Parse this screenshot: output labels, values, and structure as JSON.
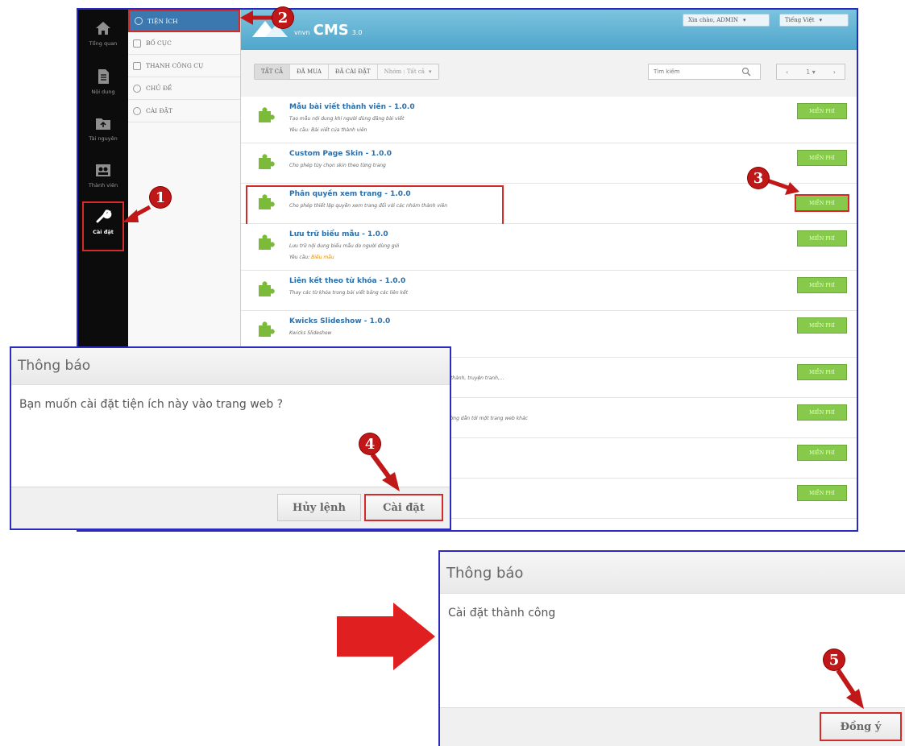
{
  "nav": {
    "items": [
      {
        "label": "Tổng quan",
        "icon": "home-icon"
      },
      {
        "label": "Nội dung",
        "icon": "document-icon"
      },
      {
        "label": "Tài nguyên",
        "icon": "folder-icon"
      },
      {
        "label": "Thành viên",
        "icon": "users-icon"
      },
      {
        "label": "Cài đặt",
        "icon": "wrench-icon"
      }
    ]
  },
  "submenu": {
    "items": [
      {
        "label": "TIỆN ÍCH"
      },
      {
        "label": "BỐ CỤC"
      },
      {
        "label": "THANH CÔNG CỤ"
      },
      {
        "label": "CHỦ ĐỀ"
      },
      {
        "label": "CÀI ĐẶT"
      }
    ]
  },
  "header": {
    "logo_small": "vnvn",
    "logo_big": "CMS",
    "logo_version": "3.0",
    "user_menu": "Xin chào, ADMIN",
    "language": "Tiếng Việt"
  },
  "toolbar": {
    "filters": [
      "TẤT CẢ",
      "ĐÃ MUA",
      "ĐÃ CÀI ĐẶT",
      "Nhóm : Tất cả"
    ],
    "search_placeholder": "Tìm kiếm",
    "page": "1"
  },
  "plugins": [
    {
      "title": "Mẫu bài viết thành viên - 1.0.0",
      "desc": "Tạo mẫu nội dung khi người dùng đăng bài viết",
      "req_label": "Yêu cầu:",
      "req_value": "Bài viết của thành viên",
      "button": "MIỄN PHÍ"
    },
    {
      "title": "Custom Page Skin - 1.0.0",
      "desc": "Cho phép tùy chọn skin theo từng trang",
      "button": "MIỄN PHÍ"
    },
    {
      "title": "Phân quyền xem trang - 1.0.0",
      "desc": "Cho phép thiết lập quyền xem trang đối với các nhóm thành viên",
      "button": "MIỄN PHÍ"
    },
    {
      "title": "Lưu trữ biểu mẫu - 1.0.0",
      "desc": "Lưu trữ nội dung biểu mẫu do người dùng gửi",
      "req_label": "Yêu cầu:",
      "req_value": "Biểu mẫu",
      "button": "MIỄN PHÍ"
    },
    {
      "title": "Liên kết theo từ khóa - 1.0.0",
      "desc": "Thay các từ khóa trong bài viết bằng các liên kết",
      "button": "MIỄN PHÍ"
    },
    {
      "title": "Kwicks Slideshow - 1.0.0",
      "desc": "Kwicks Slideshow",
      "button": "MIỄN PHÍ"
    },
    {
      "desc_tail": "ết thành, truyện tranh,...",
      "button": "MIỄN PHÍ"
    },
    {
      "desc_tail": "đường dẫn tới một trang web khác",
      "button": "MIỄN PHÍ"
    },
    {
      "button": "MIỄN PHÍ"
    },
    {
      "button": "MIỄN PHÍ"
    }
  ],
  "dialog_confirm": {
    "title": "Thông báo",
    "message": "Bạn muốn cài đặt tiện ích này vào trang web ?",
    "cancel": "Hủy lệnh",
    "confirm": "Cài đặt"
  },
  "dialog_success": {
    "title": "Thông báo",
    "message": "Cài đặt thành công",
    "ok": "Đồng ý"
  },
  "annotations": [
    "1",
    "2",
    "3",
    "4",
    "5"
  ],
  "colors": {
    "marker": "#c01818",
    "highlight": "#d42a2a",
    "frame": "#2b2bbd",
    "install": "#86c94b",
    "link": "#2c6fa8"
  }
}
